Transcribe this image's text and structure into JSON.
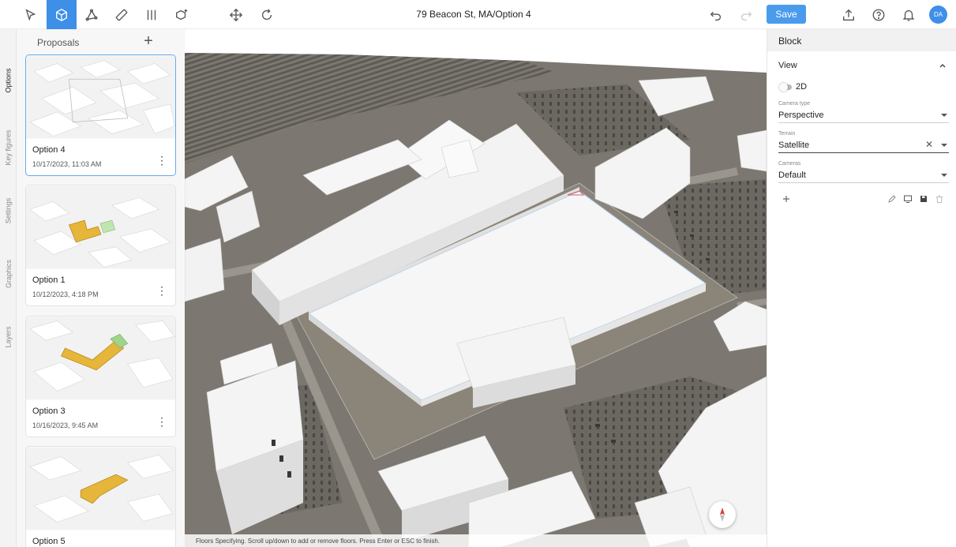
{
  "toolbar": {
    "document_title": "79 Beacon St, MA/Option 4",
    "save_label": "Save",
    "avatar_initials": "DA",
    "accent_color": "#3d8fe8"
  },
  "rail": {
    "tabs": [
      "Options",
      "Key figures",
      "Settings",
      "Graphics",
      "Layers"
    ]
  },
  "proposals": {
    "header": "Proposals",
    "items": [
      {
        "name": "Option 4",
        "date": "10/17/2023, 11:03 AM"
      },
      {
        "name": "Option 1",
        "date": "10/12/2023, 4:18 PM"
      },
      {
        "name": "Option 3",
        "date": "10/16/2023, 9:45 AM"
      },
      {
        "name": "Option 5",
        "date": ""
      }
    ]
  },
  "viewport": {
    "status_text": "Floors Specifying. Scroll up/down to add or remove floors. Press Enter or ESC to finish."
  },
  "properties": {
    "title": "Block",
    "section": "View",
    "toggle_label": "2D",
    "toggle_on": false,
    "fields": {
      "camera_type": {
        "label": "Camera type",
        "value": "Perspective"
      },
      "terrain": {
        "label": "Terrain",
        "value": "Satellite"
      },
      "cameras": {
        "label": "Cameras",
        "value": "Default"
      }
    }
  }
}
